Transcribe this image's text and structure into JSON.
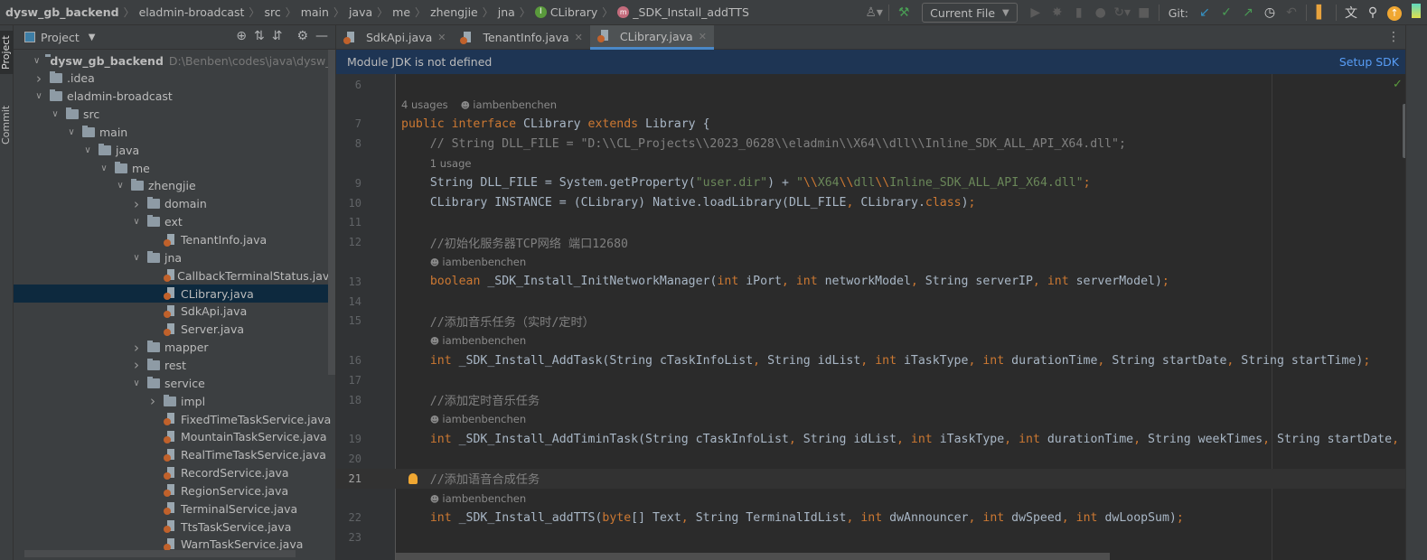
{
  "breadcrumb": [
    "dysw_gb_backend",
    "eladmin-broadcast",
    "src",
    "main",
    "java",
    "me",
    "zhengjie",
    "jna",
    "CLibrary",
    "_SDK_Install_addTTS"
  ],
  "toolbar": {
    "run_config": "Current File",
    "git_label": "Git:"
  },
  "left_stripe": {
    "project": "Project",
    "commit": "Commit"
  },
  "project_panel": {
    "title": "Project",
    "tree": [
      {
        "label": "dysw_gb_backend",
        "path": "D:\\Benben\\codes\\java\\dysw_gb_backend",
        "level": 0,
        "type": "module",
        "expanded": true
      },
      {
        "label": ".idea",
        "level": 1,
        "type": "folder",
        "expanded": false
      },
      {
        "label": "eladmin-broadcast",
        "level": 1,
        "type": "folder",
        "expanded": true
      },
      {
        "label": "src",
        "level": 2,
        "type": "folder",
        "expanded": true
      },
      {
        "label": "main",
        "level": 3,
        "type": "folder",
        "expanded": true
      },
      {
        "label": "java",
        "level": 4,
        "type": "folder",
        "expanded": true
      },
      {
        "label": "me",
        "level": 5,
        "type": "folder",
        "expanded": true
      },
      {
        "label": "zhengjie",
        "level": 6,
        "type": "folder",
        "expanded": true
      },
      {
        "label": "domain",
        "level": 7,
        "type": "folder",
        "expanded": false
      },
      {
        "label": "ext",
        "level": 7,
        "type": "folder",
        "expanded": true
      },
      {
        "label": "TenantInfo.java",
        "level": 8,
        "type": "java"
      },
      {
        "label": "jna",
        "level": 7,
        "type": "folder",
        "expanded": true
      },
      {
        "label": "CallbackTerminalStatus.java",
        "level": 8,
        "type": "java"
      },
      {
        "label": "CLibrary.java",
        "level": 8,
        "type": "java",
        "selected": true
      },
      {
        "label": "SdkApi.java",
        "level": 8,
        "type": "java"
      },
      {
        "label": "Server.java",
        "level": 8,
        "type": "java"
      },
      {
        "label": "mapper",
        "level": 7,
        "type": "folder",
        "expanded": false
      },
      {
        "label": "rest",
        "level": 7,
        "type": "folder",
        "expanded": false
      },
      {
        "label": "service",
        "level": 7,
        "type": "folder",
        "expanded": true
      },
      {
        "label": "impl",
        "level": 8,
        "type": "folder",
        "expanded": false
      },
      {
        "label": "FixedTimeTaskService.java",
        "level": 8,
        "type": "java"
      },
      {
        "label": "MountainTaskService.java",
        "level": 8,
        "type": "java"
      },
      {
        "label": "RealTimeTaskService.java",
        "level": 8,
        "type": "java"
      },
      {
        "label": "RecordService.java",
        "level": 8,
        "type": "java"
      },
      {
        "label": "RegionService.java",
        "level": 8,
        "type": "java"
      },
      {
        "label": "TerminalService.java",
        "level": 8,
        "type": "java"
      },
      {
        "label": "TtsTaskService.java",
        "level": 8,
        "type": "java"
      },
      {
        "label": "WarnTaskService.java",
        "level": 8,
        "type": "java"
      }
    ]
  },
  "tabs": [
    {
      "label": "SdkApi.java"
    },
    {
      "label": "TenantInfo.java"
    },
    {
      "label": "CLibrary.java",
      "active": true
    }
  ],
  "banner": {
    "message": "Module JDK is not defined",
    "action": "Setup SDK"
  },
  "code": [
    {
      "n": "6",
      "text": ""
    },
    {
      "inlay": "4 usages",
      "author": "iambenbenchen",
      "indent": 0
    },
    {
      "n": "7",
      "text": "public interface CLibrary extends Library {"
    },
    {
      "n": "8",
      "text": "    // String DLL_FILE = \"D:\\\\CL_Projects\\\\2023_0628\\\\eladmin\\\\X64\\\\dll\\\\Inline_SDK_ALL_API_X64.dll\";"
    },
    {
      "inlay": "1 usage",
      "indent": 4
    },
    {
      "n": "9",
      "text": "    String DLL_FILE = System.getProperty(\"user.dir\") + \"\\\\X64\\\\dll\\\\Inline_SDK_ALL_API_X64.dll\";"
    },
    {
      "n": "10",
      "text": "    CLibrary INSTANCE = (CLibrary) Native.loadLibrary(DLL_FILE, CLibrary.class);"
    },
    {
      "n": "11",
      "text": ""
    },
    {
      "n": "12",
      "text": "    //初始化服务器TCP网络 端口12680"
    },
    {
      "author": "iambenbenchen",
      "indent": 4
    },
    {
      "n": "13",
      "text": "    boolean _SDK_Install_InitNetworkManager(int iPort, int networkModel, String serverIP, int serverModel);"
    },
    {
      "n": "14",
      "text": ""
    },
    {
      "n": "15",
      "text": "    //添加音乐任务（实时/定时）"
    },
    {
      "author": "iambenbenchen",
      "indent": 4
    },
    {
      "n": "16",
      "text": "    int _SDK_Install_AddTask(String cTaskInfoList, String idList, int iTaskType, int durationTime, String startDate, String startTime);"
    },
    {
      "n": "17",
      "text": ""
    },
    {
      "n": "18",
      "text": "    //添加定时音乐任务"
    },
    {
      "author": "iambenbenchen",
      "indent": 4
    },
    {
      "n": "19",
      "text": "    int _SDK_Install_AddTiminTask(String cTaskInfoList, String idList, int iTaskType, int durationTime, String weekTimes, String startDate, S"
    },
    {
      "n": "20",
      "text": ""
    },
    {
      "n": "21",
      "text": "    //添加语音合成任务",
      "current": true,
      "bulb": true
    },
    {
      "author": "iambenbenchen",
      "indent": 4
    },
    {
      "n": "22",
      "text": "    int _SDK_Install_addTTS(byte[] Text, String TerminalIdList, int dwAnnouncer, int dwSpeed, int dwLoopSum);"
    },
    {
      "n": "23",
      "text": ""
    }
  ],
  "colors": {
    "keyword": "#cc7832",
    "string": "#6a8759",
    "comment": "#808080",
    "text": "#a9b7c6",
    "selection": "#0d293e",
    "banner": "#1e3554",
    "link": "#589df6"
  }
}
